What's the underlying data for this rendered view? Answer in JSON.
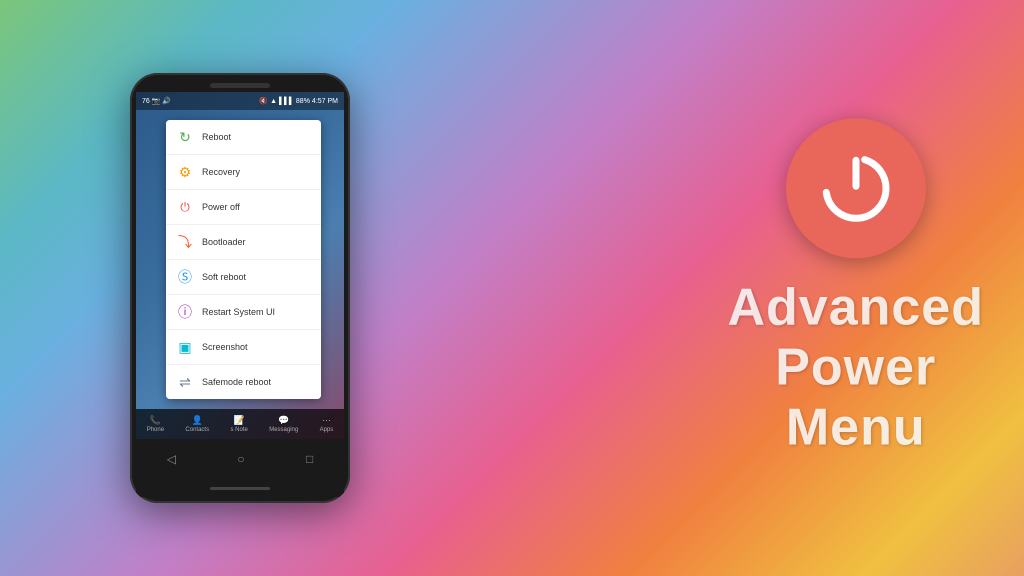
{
  "background": {
    "gradient_description": "colorful gradient green-blue-purple-pink-orange"
  },
  "power_circle": {
    "aria_label": "Power button icon"
  },
  "title": {
    "line1": "Advanced",
    "line2": "Power",
    "line3": "Menu"
  },
  "phone": {
    "status_bar": {
      "left_icons": "76 status icons",
      "right_text": "4:57 PM",
      "battery": "88%"
    },
    "menu_items": [
      {
        "id": "reboot",
        "label": "Reboot",
        "icon_color": "#4CAF50",
        "icon_char": "↻"
      },
      {
        "id": "recovery",
        "label": "Recovery",
        "icon_color": "#FF9800",
        "icon_char": "⚙"
      },
      {
        "id": "power-off",
        "label": "Power off",
        "icon_color": "#F44336",
        "icon_char": "⏻"
      },
      {
        "id": "bootloader",
        "label": "Bootloader",
        "icon_color": "#FF5722",
        "icon_char": "⤵"
      },
      {
        "id": "soft-reboot",
        "label": "Soft reboot",
        "icon_color": "#2196F3",
        "icon_char": "Ⓢ"
      },
      {
        "id": "restart-ui",
        "label": "Restart System UI",
        "icon_color": "#9C27B0",
        "icon_char": "ⓘ"
      },
      {
        "id": "screenshot",
        "label": "Screenshot",
        "icon_color": "#00BCD4",
        "icon_char": "▣"
      },
      {
        "id": "safemode",
        "label": "Safemode reboot",
        "icon_color": "#607D8B",
        "icon_char": "⇌"
      }
    ],
    "taskbar": {
      "items": [
        "Phone",
        "Contacts",
        "Note",
        "Messaging",
        "Apps"
      ]
    },
    "nav_buttons": [
      "◁",
      "○",
      "□"
    ]
  }
}
